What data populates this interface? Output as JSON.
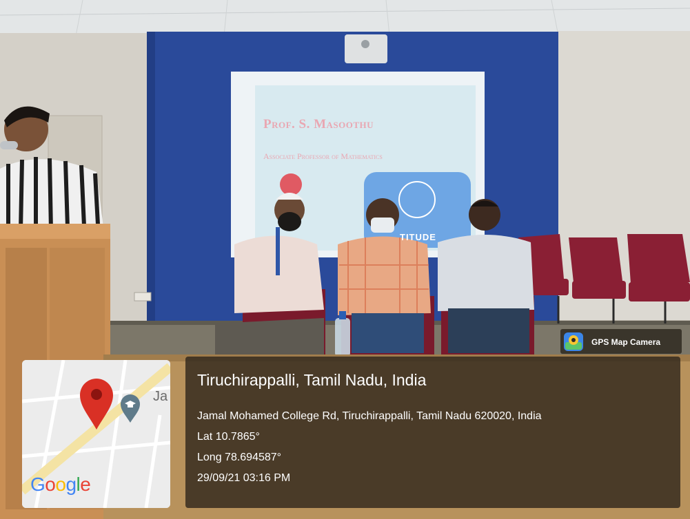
{
  "slide": {
    "title": "Prof. S. Masoothu",
    "subtitle": "Associate Professor of Mathematics",
    "logo_text": "TITUDE"
  },
  "gps_badge": {
    "label": "GPS Map Camera",
    "icon": "gps-map-camera-app-icon"
  },
  "location": {
    "title": "Tiruchirappalli, Tamil Nadu, India",
    "address": "Jamal Mohamed College Rd, Tiruchirappalli, Tamil Nadu 620020, India",
    "lat": "Lat 10.7865°",
    "long": "Long 78.694587°",
    "datetime": "29/09/21 03:16 PM"
  },
  "map": {
    "place_fragment": "Ja",
    "logo_letters": [
      "G",
      "o",
      "o",
      "g",
      "l",
      "e"
    ],
    "logo_colors": [
      "#4285F4",
      "#EA4335",
      "#FBBC05",
      "#4285F4",
      "#34A853",
      "#EA4335"
    ],
    "marker_color": "#d93025",
    "poi_icon": "education-cap-icon"
  },
  "colors": {
    "wall_blue": "#2a4a9a",
    "chair_red": "#8a1f34",
    "overlay_bg": "#2e261c"
  }
}
